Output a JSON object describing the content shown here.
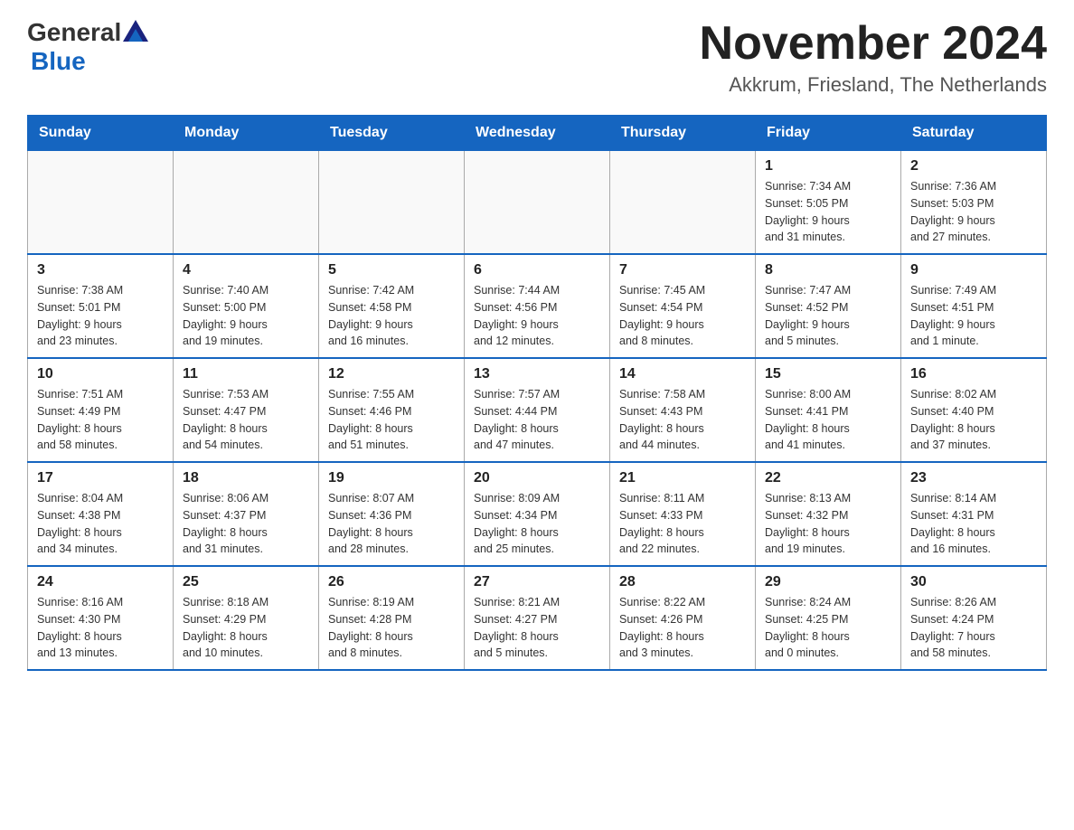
{
  "header": {
    "logo_general": "General",
    "logo_blue": "Blue",
    "month_year": "November 2024",
    "location": "Akkrum, Friesland, The Netherlands"
  },
  "weekdays": [
    "Sunday",
    "Monday",
    "Tuesday",
    "Wednesday",
    "Thursday",
    "Friday",
    "Saturday"
  ],
  "weeks": [
    [
      {
        "day": "",
        "info": ""
      },
      {
        "day": "",
        "info": ""
      },
      {
        "day": "",
        "info": ""
      },
      {
        "day": "",
        "info": ""
      },
      {
        "day": "",
        "info": ""
      },
      {
        "day": "1",
        "info": "Sunrise: 7:34 AM\nSunset: 5:05 PM\nDaylight: 9 hours\nand 31 minutes."
      },
      {
        "day": "2",
        "info": "Sunrise: 7:36 AM\nSunset: 5:03 PM\nDaylight: 9 hours\nand 27 minutes."
      }
    ],
    [
      {
        "day": "3",
        "info": "Sunrise: 7:38 AM\nSunset: 5:01 PM\nDaylight: 9 hours\nand 23 minutes."
      },
      {
        "day": "4",
        "info": "Sunrise: 7:40 AM\nSunset: 5:00 PM\nDaylight: 9 hours\nand 19 minutes."
      },
      {
        "day": "5",
        "info": "Sunrise: 7:42 AM\nSunset: 4:58 PM\nDaylight: 9 hours\nand 16 minutes."
      },
      {
        "day": "6",
        "info": "Sunrise: 7:44 AM\nSunset: 4:56 PM\nDaylight: 9 hours\nand 12 minutes."
      },
      {
        "day": "7",
        "info": "Sunrise: 7:45 AM\nSunset: 4:54 PM\nDaylight: 9 hours\nand 8 minutes."
      },
      {
        "day": "8",
        "info": "Sunrise: 7:47 AM\nSunset: 4:52 PM\nDaylight: 9 hours\nand 5 minutes."
      },
      {
        "day": "9",
        "info": "Sunrise: 7:49 AM\nSunset: 4:51 PM\nDaylight: 9 hours\nand 1 minute."
      }
    ],
    [
      {
        "day": "10",
        "info": "Sunrise: 7:51 AM\nSunset: 4:49 PM\nDaylight: 8 hours\nand 58 minutes."
      },
      {
        "day": "11",
        "info": "Sunrise: 7:53 AM\nSunset: 4:47 PM\nDaylight: 8 hours\nand 54 minutes."
      },
      {
        "day": "12",
        "info": "Sunrise: 7:55 AM\nSunset: 4:46 PM\nDaylight: 8 hours\nand 51 minutes."
      },
      {
        "day": "13",
        "info": "Sunrise: 7:57 AM\nSunset: 4:44 PM\nDaylight: 8 hours\nand 47 minutes."
      },
      {
        "day": "14",
        "info": "Sunrise: 7:58 AM\nSunset: 4:43 PM\nDaylight: 8 hours\nand 44 minutes."
      },
      {
        "day": "15",
        "info": "Sunrise: 8:00 AM\nSunset: 4:41 PM\nDaylight: 8 hours\nand 41 minutes."
      },
      {
        "day": "16",
        "info": "Sunrise: 8:02 AM\nSunset: 4:40 PM\nDaylight: 8 hours\nand 37 minutes."
      }
    ],
    [
      {
        "day": "17",
        "info": "Sunrise: 8:04 AM\nSunset: 4:38 PM\nDaylight: 8 hours\nand 34 minutes."
      },
      {
        "day": "18",
        "info": "Sunrise: 8:06 AM\nSunset: 4:37 PM\nDaylight: 8 hours\nand 31 minutes."
      },
      {
        "day": "19",
        "info": "Sunrise: 8:07 AM\nSunset: 4:36 PM\nDaylight: 8 hours\nand 28 minutes."
      },
      {
        "day": "20",
        "info": "Sunrise: 8:09 AM\nSunset: 4:34 PM\nDaylight: 8 hours\nand 25 minutes."
      },
      {
        "day": "21",
        "info": "Sunrise: 8:11 AM\nSunset: 4:33 PM\nDaylight: 8 hours\nand 22 minutes."
      },
      {
        "day": "22",
        "info": "Sunrise: 8:13 AM\nSunset: 4:32 PM\nDaylight: 8 hours\nand 19 minutes."
      },
      {
        "day": "23",
        "info": "Sunrise: 8:14 AM\nSunset: 4:31 PM\nDaylight: 8 hours\nand 16 minutes."
      }
    ],
    [
      {
        "day": "24",
        "info": "Sunrise: 8:16 AM\nSunset: 4:30 PM\nDaylight: 8 hours\nand 13 minutes."
      },
      {
        "day": "25",
        "info": "Sunrise: 8:18 AM\nSunset: 4:29 PM\nDaylight: 8 hours\nand 10 minutes."
      },
      {
        "day": "26",
        "info": "Sunrise: 8:19 AM\nSunset: 4:28 PM\nDaylight: 8 hours\nand 8 minutes."
      },
      {
        "day": "27",
        "info": "Sunrise: 8:21 AM\nSunset: 4:27 PM\nDaylight: 8 hours\nand 5 minutes."
      },
      {
        "day": "28",
        "info": "Sunrise: 8:22 AM\nSunset: 4:26 PM\nDaylight: 8 hours\nand 3 minutes."
      },
      {
        "day": "29",
        "info": "Sunrise: 8:24 AM\nSunset: 4:25 PM\nDaylight: 8 hours\nand 0 minutes."
      },
      {
        "day": "30",
        "info": "Sunrise: 8:26 AM\nSunset: 4:24 PM\nDaylight: 7 hours\nand 58 minutes."
      }
    ]
  ]
}
